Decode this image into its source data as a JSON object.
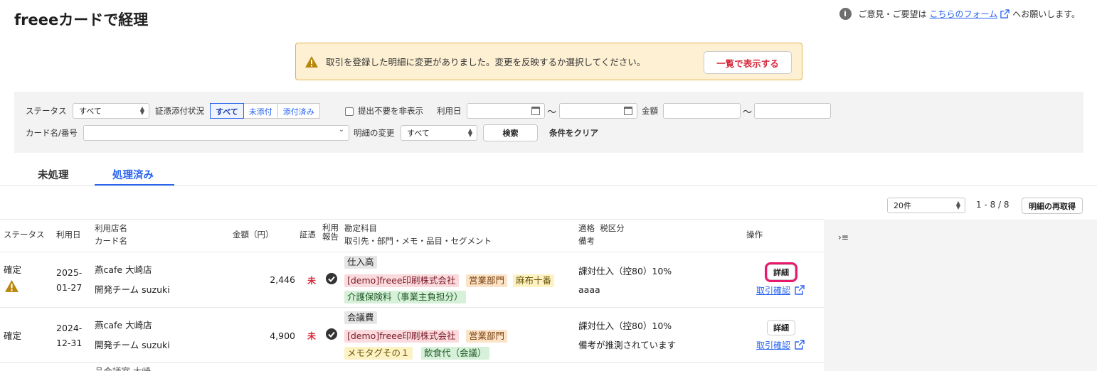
{
  "header": {
    "title": "freeeカードで経理",
    "feedback_prefix": "ご意見・ご要望は",
    "feedback_link": "こちらのフォーム",
    "feedback_suffix": "へお願いします。"
  },
  "banner": {
    "message": "取引を登録した明細に変更がありました。変更を反映するか選択してください。",
    "button": "一覧で表示する"
  },
  "filters": {
    "status_label": "ステータス",
    "status_value": "すべて",
    "evidence_label": "証憑添付状況",
    "evidence_options": [
      "すべて",
      "未添付",
      "添付済み"
    ],
    "hide_unneeded": "提出不要を非表示",
    "date_label": "利用日",
    "amount_label": "金額",
    "range_sep": "〜",
    "card_label": "カード名/番号",
    "change_label": "明細の変更",
    "change_value": "すべて",
    "search": "検索",
    "clear": "条件をクリア"
  },
  "tabs": [
    "未処理",
    "処理済み"
  ],
  "pager": {
    "per_page": "20件",
    "range": "1 - 8 / 8",
    "refetch": "明細の再取得"
  },
  "table": {
    "headers": {
      "status": "ステータス",
      "date": "利用日",
      "shop": "利用店名",
      "card": "カード名",
      "amount": "金額（円）",
      "evidence": "証憑",
      "report_1": "利用",
      "report_2": "報告",
      "account": "勘定科目",
      "account_sub": "取引先・部門・メモ・品目・セグメント",
      "tax": "適格  税区分",
      "note": "備考",
      "ops": "操作"
    },
    "rows": [
      {
        "status": "確定",
        "date_y": "2025-",
        "date_md": "01-27",
        "shop": "燕cafe 大崎店",
        "card": "開発チーム suzuki",
        "amount": "2,446",
        "evidence": "未",
        "account": "仕入高",
        "tags": [
          "[demo]freee印刷株式会社",
          "営業部門",
          "麻布十番",
          "介護保険料（事業主負担分）"
        ],
        "tax": "課対仕入（控80）10%",
        "note": "aaaa",
        "detail": "詳細",
        "confirm": "取引確認"
      },
      {
        "status": "確定",
        "date_y": "2024-",
        "date_md": "12-31",
        "shop": "燕cafe 大崎店",
        "card": "開発チーム suzuki",
        "amount": "4,900",
        "evidence": "未",
        "account": "会議費",
        "tags": [
          "[demo]freee印刷株式会社",
          "営業部門",
          "メモタグその１",
          "飲食代（会議）"
        ],
        "tax": "課対仕入（控80）10%",
        "note": "備考が推測されています",
        "detail": "詳細",
        "confirm": "取引確認"
      }
    ],
    "partial_row_shop": "品会議室 大崎"
  },
  "colors": {
    "accent": "#2864f0",
    "danger": "#d6283b",
    "highlight": "#e8196c"
  }
}
